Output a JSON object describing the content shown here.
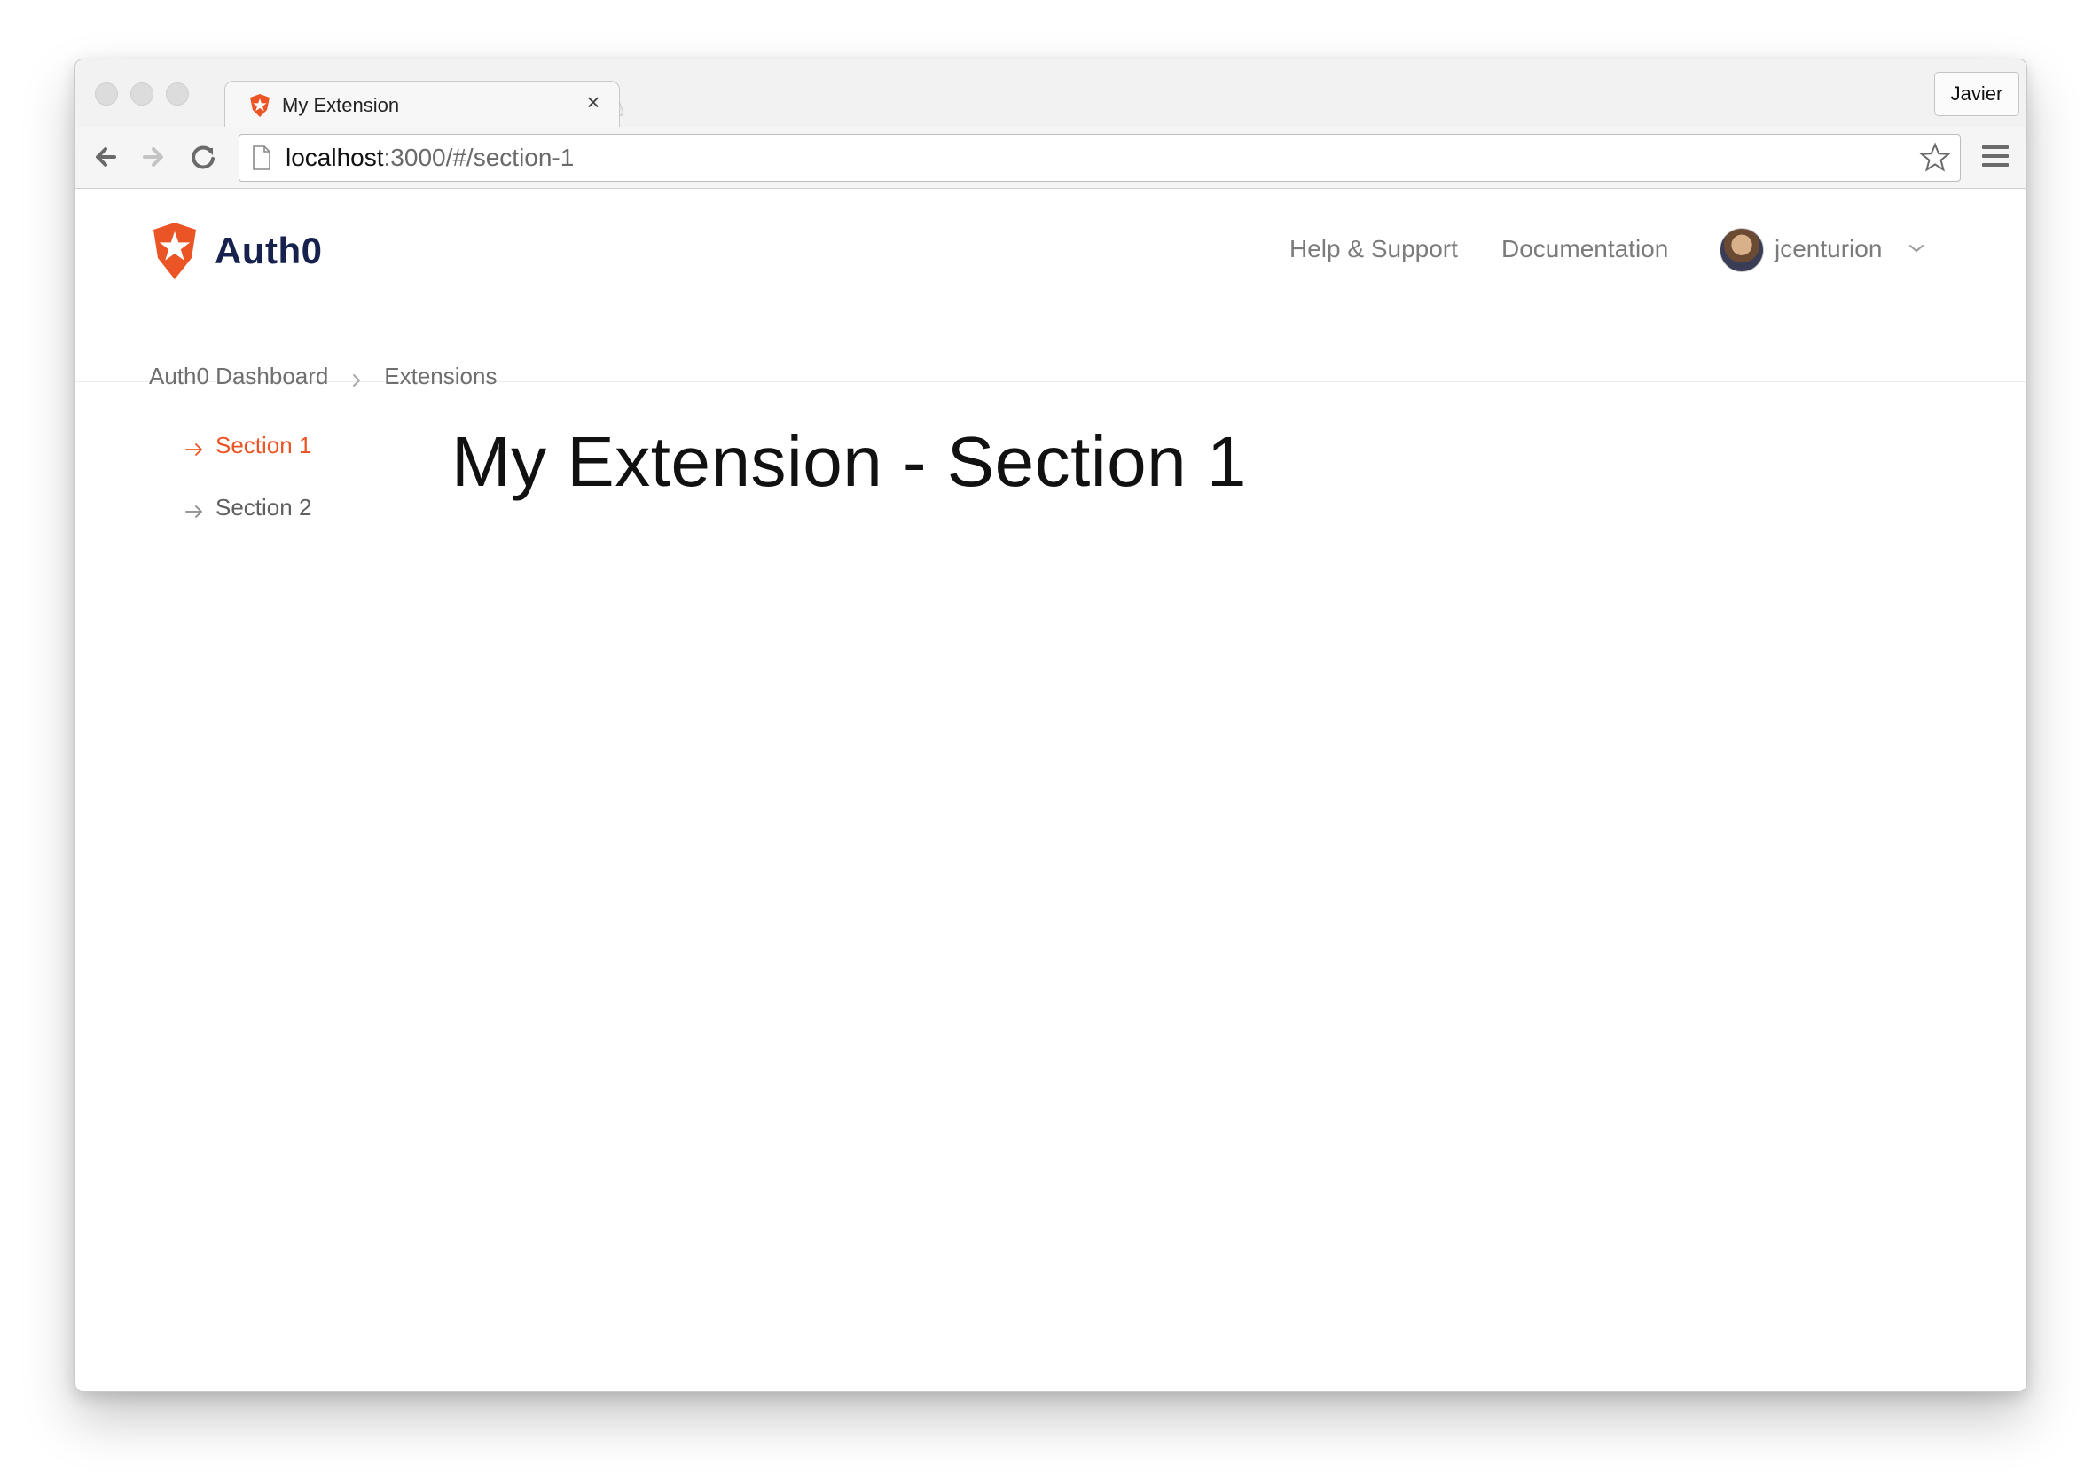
{
  "browser": {
    "tab": {
      "title": "My Extension",
      "close_glyph": "×",
      "favicon": "auth0-logo-icon"
    },
    "profile_button": "Javier",
    "address_bar": {
      "host": "localhost",
      "path": ":3000/#/section-1"
    },
    "icons": {
      "back": "arrow-left-icon",
      "forward": "arrow-right-icon",
      "reload": "reload-icon",
      "page": "document-icon",
      "bookmark": "star-icon",
      "menu": "hamburger-menu-icon"
    }
  },
  "header": {
    "brand": {
      "name": "Auth0",
      "logo": "auth0-logo-icon"
    },
    "links": [
      {
        "label": "Help & Support"
      },
      {
        "label": "Documentation"
      }
    ],
    "user": {
      "name": "jcenturion",
      "avatar": "avatar-photo",
      "chevron": "chevron-down-icon"
    }
  },
  "breadcrumb": {
    "items": [
      "Auth0 Dashboard",
      "Extensions"
    ],
    "separator": "chevron-right-icon"
  },
  "sidebar": {
    "items": [
      {
        "label": "Section 1",
        "active": true
      },
      {
        "label": "Section 2",
        "active": false
      }
    ],
    "arrow": "arrow-right-icon"
  },
  "main": {
    "title": "My Extension - Section 1"
  },
  "colors": {
    "accent": "#eb5424",
    "brand_text": "#16214d",
    "muted_text": "#7b7b7b"
  }
}
